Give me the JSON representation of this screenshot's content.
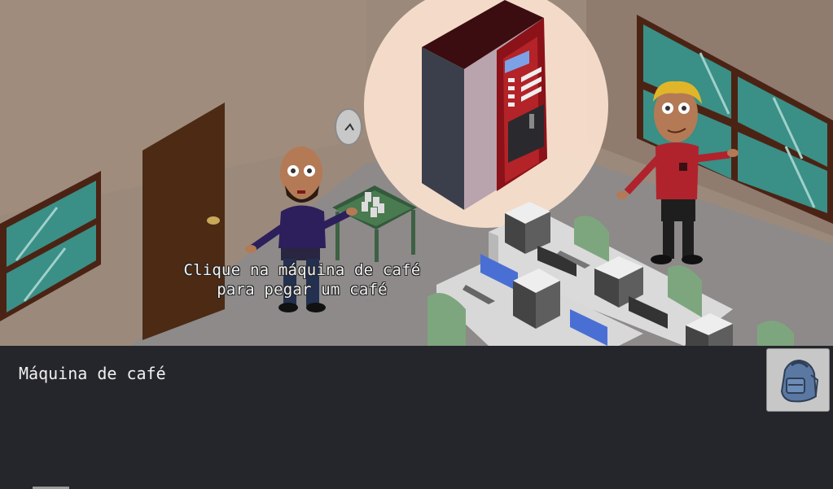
{
  "scene": {
    "hint_lines": [
      "Clique na máquina de café",
      "para pegar um café"
    ],
    "objects": [
      "office-door-icon",
      "wall-clock-icon",
      "coffee-machine-icon",
      "side-table-icon",
      "coffee-cups-icon",
      "window-icon",
      "desk-icon",
      "computer-monitor-icon",
      "office-chair-icon"
    ],
    "characters": [
      "bald-bearded-man",
      "blond-man"
    ]
  },
  "panel": {
    "hover_label": "Máquina de café",
    "inventory_icon": "backpack-icon"
  },
  "colors": {
    "wall": "#9c8a7c",
    "floor": "#8e8b8a",
    "panel": "#25262b",
    "highlight": "#fbe1cf",
    "machine_red": "#b32328"
  }
}
